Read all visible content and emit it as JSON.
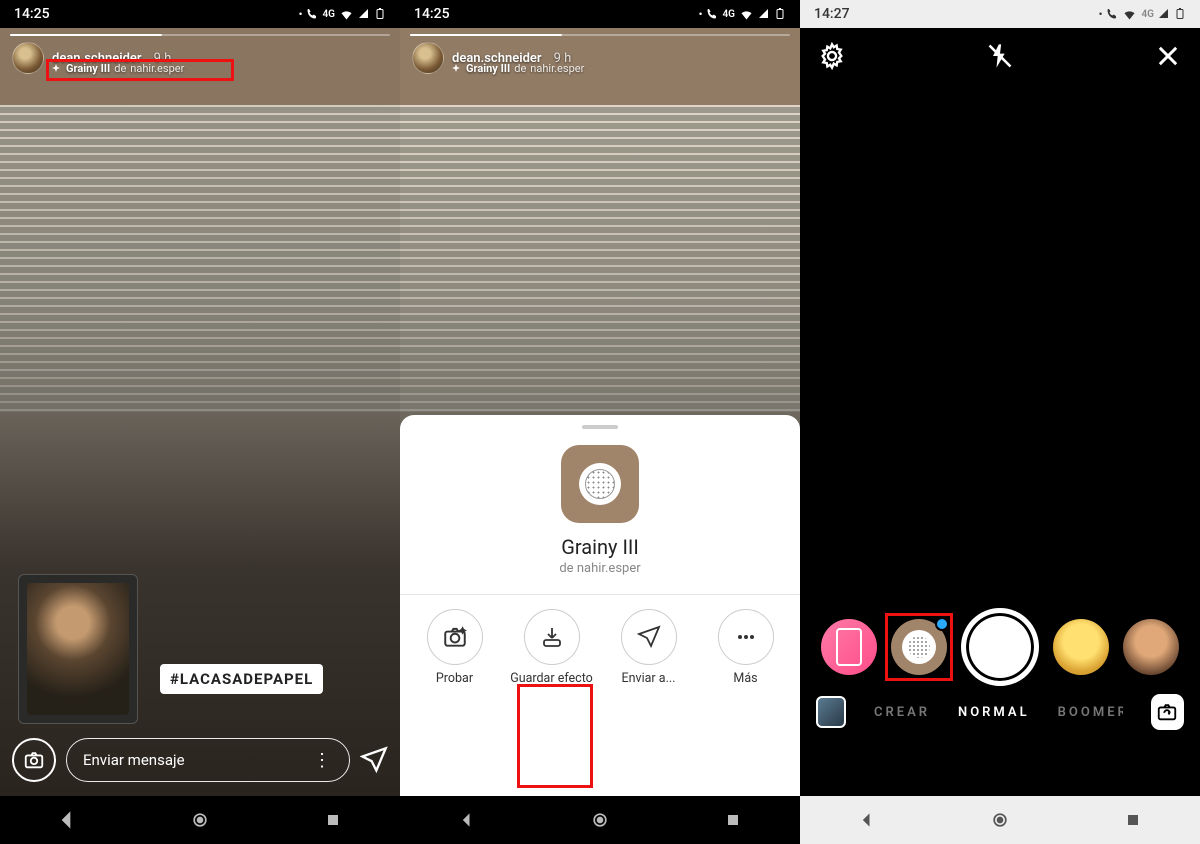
{
  "screen1": {
    "status_time": "14:25",
    "network_label": "4G",
    "username": "dean.schneider",
    "time_ago": "9 h",
    "effect_name": "Grainy III",
    "effect_by_prefix": "de",
    "effect_author": "nahir.esper",
    "hashtag": "#LACASADEPAPEL",
    "message_placeholder": "Enviar mensaje"
  },
  "screen2": {
    "status_time": "14:25",
    "network_label": "4G",
    "username": "dean.schneider",
    "time_ago": "9 h",
    "effect_name_header": "Grainy III",
    "effect_by_prefix_header": "de",
    "effect_author_header": "nahir.esper",
    "sheet_title": "Grainy III",
    "sheet_author_prefix": "de",
    "sheet_author": "nahir.esper",
    "actions": {
      "try": "Probar",
      "save": "Guardar efecto",
      "send": "Enviar a...",
      "more": "Más"
    }
  },
  "screen3": {
    "status_time": "14:27",
    "network_label": "4G",
    "modes": {
      "create": "CREAR",
      "normal": "NORMAL",
      "boomerang": "BOOMERANG"
    }
  }
}
